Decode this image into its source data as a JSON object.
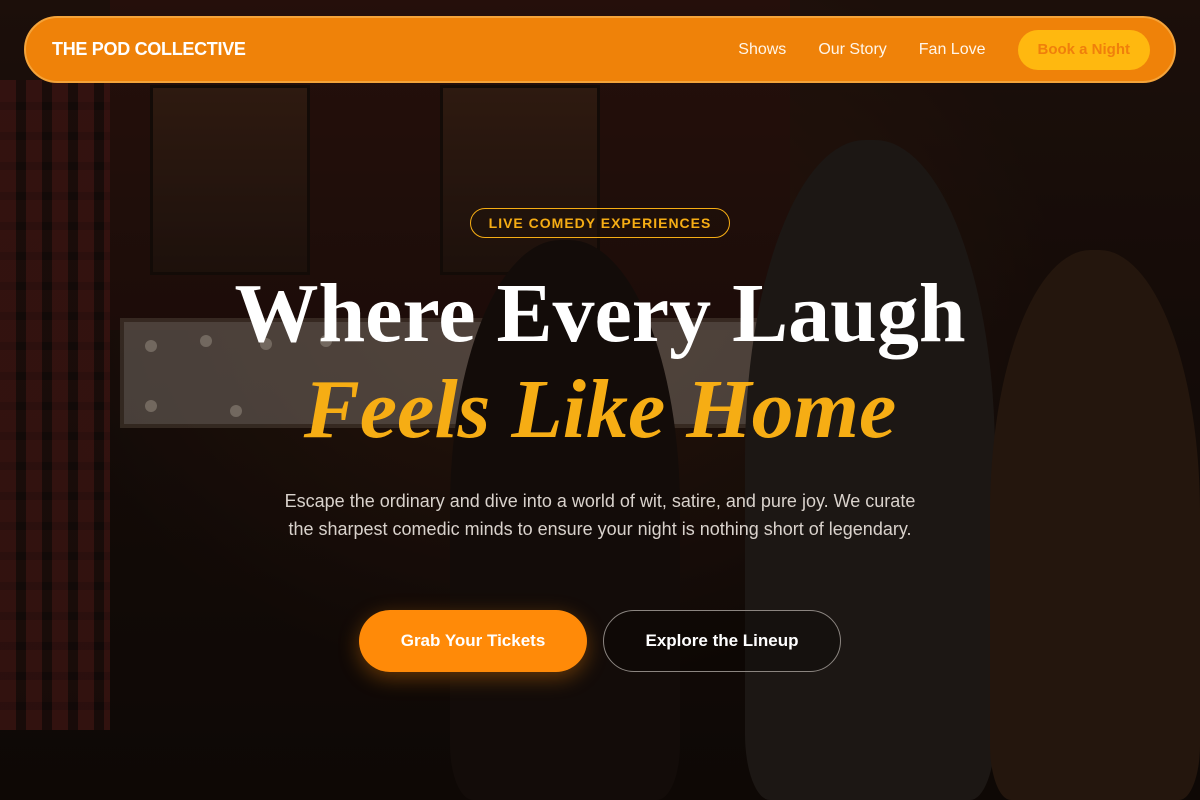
{
  "nav": {
    "brand": "THE POD COLLECTIVE",
    "links": [
      "Shows",
      "Our Story",
      "Fan Love"
    ],
    "cta": "Book a Night"
  },
  "hero": {
    "badge": "LIVE COMEDY EXPERIENCES",
    "headline": "Where Every Laugh",
    "headline_accent": "Feels Like Home",
    "subtext": "Escape the ordinary and dive into a world of wit, satire, and pure joy. We curate the sharpest comedic minds to ensure your night is nothing short of legendary.",
    "primary_button": "Grab Your Tickets",
    "secondary_button": "Explore the Lineup"
  },
  "colors": {
    "brand_orange": "#ef8209",
    "accent_gold": "#f6ad14",
    "cta_orange": "#ff8a08"
  }
}
